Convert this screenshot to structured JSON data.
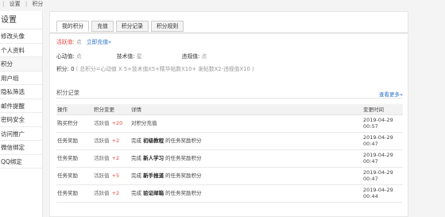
{
  "breadcrumb": {
    "items": [
      "设置",
      "积分"
    ]
  },
  "sidebar": {
    "title": "设置",
    "items": [
      {
        "label": "修改头像"
      },
      {
        "label": "个人资料"
      },
      {
        "label": "积分"
      },
      {
        "label": "用户组"
      },
      {
        "label": "隐私筛选"
      },
      {
        "label": "邮件提醒"
      },
      {
        "label": "密码安全"
      },
      {
        "label": "访问推广"
      },
      {
        "label": "微信绑定"
      },
      {
        "label": "QQ绑定"
      }
    ],
    "active_index": 2
  },
  "tabs": [
    {
      "label": "我的积分",
      "active": true
    },
    {
      "label": "充值",
      "active": false
    },
    {
      "label": "积分记录",
      "active": false
    },
    {
      "label": "积分规则",
      "active": false
    }
  ],
  "summary": {
    "activity_label": "活跃值:",
    "activity_value": "点",
    "recharge_link": "立即充值»",
    "heart_label": "心动值:",
    "heart_value": "点",
    "tech_label": "技术值:",
    "tech_value": "星",
    "violation_label": "违规值:",
    "violation_value": "点",
    "total_label": "积分:",
    "total_value": "0",
    "formula": "( 总积分=心动值 X 5+技术值X5+精华帖数X10+ 发帖数X2-违规值X10 )"
  },
  "records": {
    "title": "积分记录",
    "more_link": "查看更多»",
    "columns": [
      "操作",
      "积分变更",
      "详情",
      "变更时间"
    ],
    "rows": [
      {
        "operation": "购买积分",
        "change_label": "活跃值",
        "change_value": "+20",
        "detail_prefix": "对积分充值",
        "detail_strong": "",
        "detail_suffix": "",
        "time": "2019-04-29 00:57"
      },
      {
        "operation": "任务奖励",
        "change_label": "活跃值",
        "change_value": "+2",
        "detail_prefix": "完成",
        "detail_strong": "初级教程",
        "detail_suffix": "的任务奖励积分",
        "time": "2019-04-29 00:47"
      },
      {
        "operation": "任务奖励",
        "change_label": "活跃值",
        "change_value": "+2",
        "detail_prefix": "完成",
        "detail_strong": "新人学习",
        "detail_suffix": "的任务奖励积分",
        "time": "2019-04-29 00:47"
      },
      {
        "operation": "任务奖励",
        "change_label": "活跃值",
        "change_value": "+5",
        "detail_prefix": "完成",
        "detail_strong": "新手报道",
        "detail_suffix": "的任务奖励积分",
        "time": "2019-04-29 00:47"
      },
      {
        "operation": "任务奖励",
        "change_label": "活跃值",
        "change_value": "+2",
        "detail_prefix": "完成",
        "detail_strong": "验证邮箱",
        "detail_suffix": "的任务奖励积分",
        "time": "2019-04-29 00:44"
      }
    ]
  }
}
